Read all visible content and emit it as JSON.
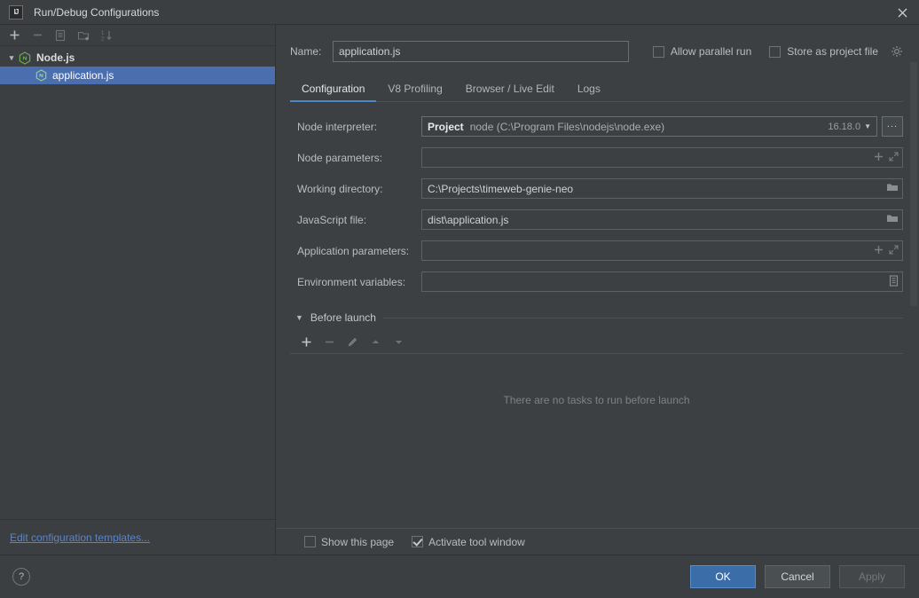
{
  "window": {
    "title": "Run/Debug Configurations",
    "logo_text": "IJ",
    "close_icon": "close-icon"
  },
  "sidebar": {
    "toolbar": [
      {
        "name": "add-configuration-button",
        "icon": "plus-icon",
        "enabled": true
      },
      {
        "name": "remove-configuration-button",
        "icon": "minus-icon",
        "enabled": false
      },
      {
        "name": "copy-configuration-button",
        "icon": "copy-icon",
        "enabled": false
      },
      {
        "name": "new-folder-button",
        "icon": "folder-add-icon",
        "enabled": false
      },
      {
        "name": "sort-configurations-button",
        "icon": "sort-alpha-icon",
        "enabled": false
      }
    ],
    "tree": [
      {
        "label": "Node.js",
        "type": "group",
        "icon": "nodejs-icon",
        "expanded": true,
        "caret": "⌄",
        "selected": false
      },
      {
        "label": "application.js",
        "type": "child",
        "icon": "nodejs-icon",
        "selected": true
      }
    ],
    "footer_link": "Edit configuration templates..."
  },
  "main": {
    "name_label": "Name:",
    "name_value": "application.js",
    "name_placeholder": "",
    "allow_parallel_run": {
      "label": "Allow parallel run",
      "checked": false
    },
    "store_as_project_file": {
      "label": "Store as project file",
      "checked": false,
      "gear_icon": "gear-icon"
    },
    "tabs": [
      {
        "label": "Configuration",
        "active": true
      },
      {
        "label": "V8 Profiling",
        "active": false
      },
      {
        "label": "Browser / Live Edit",
        "active": false
      },
      {
        "label": "Logs",
        "active": false
      }
    ],
    "fields": {
      "node_interpreter": {
        "label": "Node interpreter:",
        "scope": "Project",
        "value": "node (C:\\Program Files\\nodejs\\node.exe)",
        "version": "16.18.0",
        "dropdown_icon": "chevron-down-icon",
        "browse_label": "..."
      },
      "node_parameters": {
        "label": "Node parameters:",
        "value": "",
        "placeholder": "",
        "icons": [
          "plus-icon",
          "expand-icon"
        ]
      },
      "working_directory": {
        "label": "Working directory:",
        "value": "C:\\Projects\\timeweb-genie-neo",
        "icons": [
          "folder-icon"
        ]
      },
      "javascript_file": {
        "label": "JavaScript file:",
        "value": "dist\\application.js",
        "icons": [
          "folder-icon"
        ]
      },
      "application_parameters": {
        "label": "Application parameters:",
        "value": "",
        "placeholder": "",
        "icons": [
          "plus-icon",
          "expand-icon"
        ]
      },
      "environment_variables": {
        "label": "Environment variables:",
        "value": "",
        "placeholder": "",
        "icons": [
          "list-edit-icon"
        ]
      }
    },
    "before_launch": {
      "title": "Before launch",
      "caret": "▼",
      "toolbar": [
        {
          "name": "add-task-button",
          "icon": "plus-icon",
          "enabled": true
        },
        {
          "name": "remove-task-button",
          "icon": "minus-icon",
          "enabled": false
        },
        {
          "name": "edit-task-button",
          "icon": "pencil-icon",
          "enabled": false
        },
        {
          "name": "move-task-up-button",
          "icon": "arrow-up-icon",
          "enabled": false
        },
        {
          "name": "move-task-down-button",
          "icon": "arrow-down-icon",
          "enabled": false
        }
      ],
      "empty_text": "There are no tasks to run before launch"
    },
    "options": {
      "show_this_page": {
        "label": "Show this page",
        "checked": false
      },
      "activate_tool_window": {
        "label": "Activate tool window",
        "checked": true
      }
    }
  },
  "footer": {
    "help_label": "?",
    "ok_label": "OK",
    "cancel_label": "Cancel",
    "apply_label": "Apply"
  },
  "colors": {
    "dialog_bg": "#3c3f41",
    "panel_bg": "#3c4043",
    "selection_blue": "#4b6eaf",
    "accent_blue": "#4a88c7",
    "link_blue": "#5c84c4",
    "primary_button": "#3b6ea8",
    "node_green": "#6aa84f",
    "text": "#bbbbbb"
  }
}
